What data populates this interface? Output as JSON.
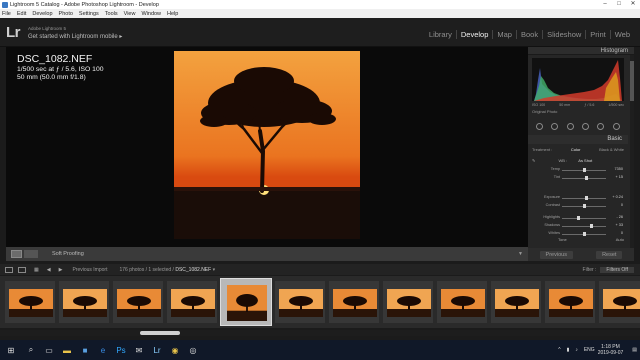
{
  "window": {
    "title": "Lightroom 5 Catalog - Adobe Photoshop Lightroom - Develop",
    "menu": [
      "File",
      "Edit",
      "Develop",
      "Photo",
      "Settings",
      "Tools",
      "View",
      "Window",
      "Help"
    ]
  },
  "identity": {
    "logo": "Lr",
    "version": "Adobe Lightroom 5",
    "mobile": "Get started with Lightroom mobile ▸"
  },
  "modules": [
    "Library",
    "Develop",
    "Map",
    "Book",
    "Slideshow",
    "Print",
    "Web"
  ],
  "active_module": "Develop",
  "overlay": {
    "filename": "DSC_1082.NEF",
    "exposure": "1/500 sec at ƒ / 5.6, ISO 100",
    "lens": "50 mm (50.0 mm f/1.8)"
  },
  "toolbar": {
    "soft_proofing": "Soft Proofing"
  },
  "right_panel": {
    "histogram_label": "Histogram",
    "histogram_info": [
      "ISO 100",
      "50 mm",
      "ƒ / 5.6",
      "1/500 sec"
    ],
    "original_photo": "Original Photo",
    "basic_label": "Basic",
    "treatment": [
      "Treatment :",
      "Color",
      "Black & White"
    ],
    "wb_label": "WB :",
    "wb_value": "As Shot",
    "tone_label": "Tone",
    "auto_label": "Auto",
    "sliders": [
      {
        "label": "Temp",
        "value": "7350",
        "pos": 0.5
      },
      {
        "label": "Tint",
        "value": "+ 15",
        "pos": 0.55
      },
      {
        "label": "Exposure",
        "value": "+ 0.24",
        "pos": 0.55
      },
      {
        "label": "Contrast",
        "value": "0",
        "pos": 0.5
      },
      {
        "label": "Highlights",
        "value": "- 26",
        "pos": 0.38
      },
      {
        "label": "Shadows",
        "value": "+ 33",
        "pos": 0.66
      },
      {
        "label": "Whites",
        "value": "0",
        "pos": 0.5
      }
    ]
  },
  "buttons": {
    "previous": "Previous",
    "reset": "Reset"
  },
  "filmstrip": {
    "nav_1": "1",
    "nav_2": "2",
    "previous_import": "Previous Import",
    "count": "176 photos / 1 selected /",
    "selected_file": "DSC_1082.NEF",
    "filter_label": "Filter :",
    "filter_value": "Filters Off",
    "selected_index": 4,
    "thumb_count": 12
  },
  "taskbar": {
    "lang": "ENG",
    "time": "1:18 PM",
    "date": "2019-09-07"
  },
  "colors": {
    "sky_top": "#f3a23f",
    "sky_bottom": "#e35a12",
    "ground": "#1a0d08",
    "active_module": "#f0f0f0"
  }
}
